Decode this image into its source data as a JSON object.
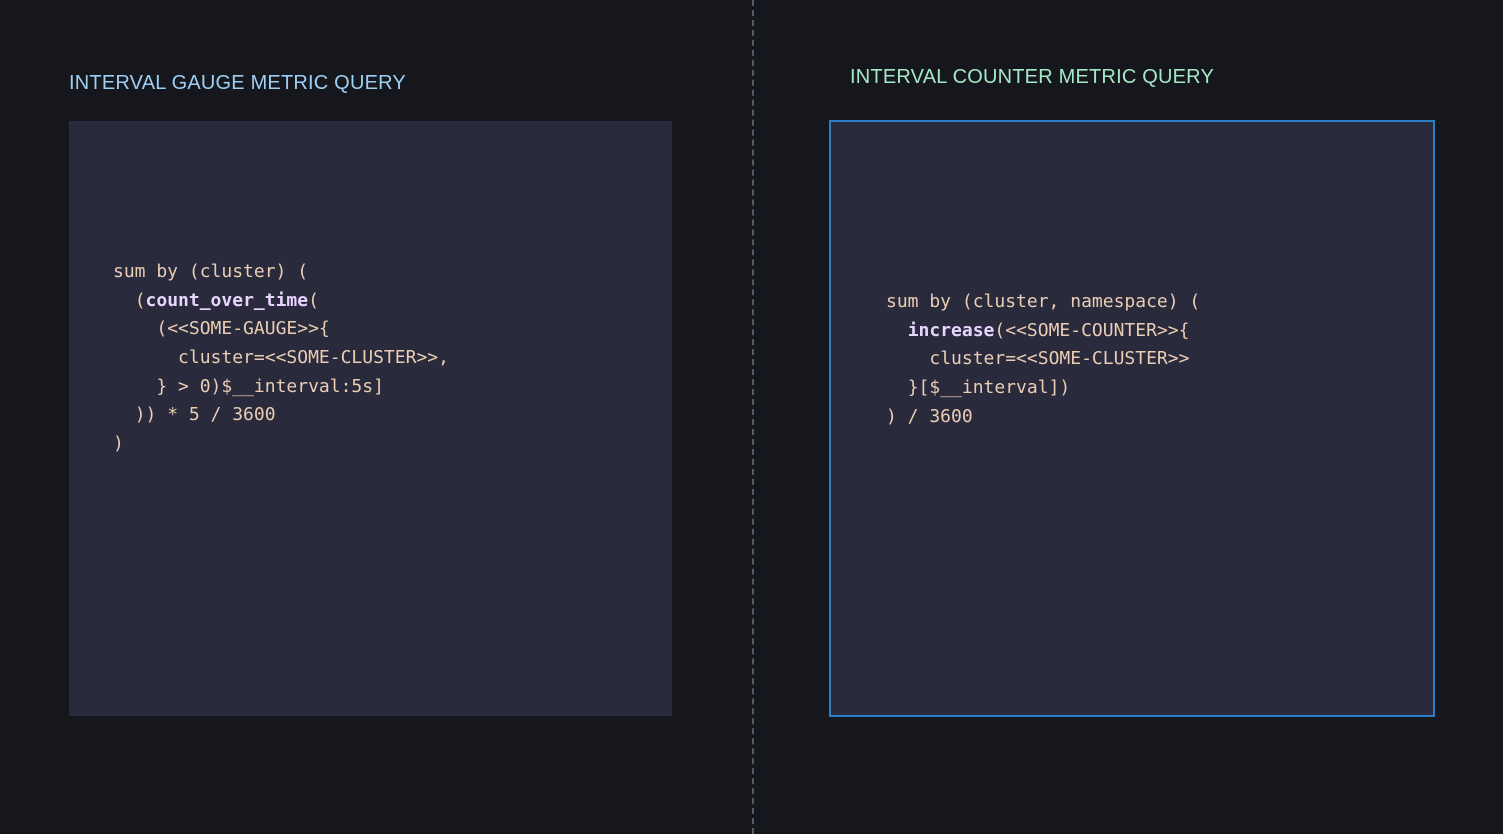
{
  "left": {
    "title": "INTERVAL GAUGE METRIC QUERY",
    "code": [
      {
        "indent": "",
        "pre": "sum by (cluster) (",
        "fn": "",
        "post": ""
      },
      {
        "indent": "  ",
        "pre": "(",
        "fn": "count_over_time",
        "post": "("
      },
      {
        "indent": "    ",
        "pre": "(<<SOME-GAUGE>>{",
        "fn": "",
        "post": ""
      },
      {
        "indent": "      ",
        "pre": "cluster=<<SOME-CLUSTER>>,",
        "fn": "",
        "post": ""
      },
      {
        "indent": "    ",
        "pre": "} > 0)$__interval:5s]",
        "fn": "",
        "post": ""
      },
      {
        "indent": "  ",
        "pre": ")) * 5 / 3600",
        "fn": "",
        "post": ""
      },
      {
        "indent": "",
        "pre": ")",
        "fn": "",
        "post": ""
      }
    ]
  },
  "right": {
    "title": "INTERVAL COUNTER METRIC QUERY",
    "code": [
      {
        "indent": "",
        "pre": "sum by (cluster, namespace) (",
        "fn": "",
        "post": ""
      },
      {
        "indent": "  ",
        "pre": "",
        "fn": "increase",
        "post": "(<<SOME-COUNTER>>{"
      },
      {
        "indent": "    ",
        "pre": "cluster=<<SOME-CLUSTER>>",
        "fn": "",
        "post": ""
      },
      {
        "indent": "  ",
        "pre": "}[$__interval])",
        "fn": "",
        "post": ""
      },
      {
        "indent": "",
        "pre": ") / 3600",
        "fn": "",
        "post": ""
      }
    ]
  },
  "colors": {
    "background": "#16171d",
    "panel": "#292a3b",
    "left_title": "#9dcff3",
    "right_title": "#a5e8c8",
    "code_text": "#eacdb4",
    "function_text": "#e8d4ff",
    "selected_border": "#2b7fc6",
    "divider": "#555a66"
  }
}
